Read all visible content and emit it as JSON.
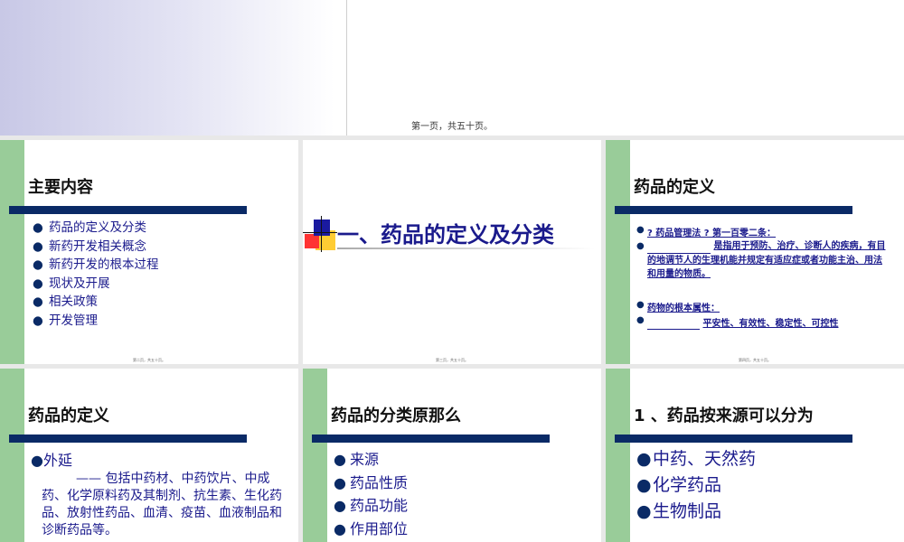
{
  "top_caption": "第一页，共五十页。",
  "slide2": {
    "title": "主要内容",
    "items": [
      "药品的定义及分类",
      "新药开发相关概念",
      "新药开发的根本过程",
      "现状及开展",
      "相关政策",
      "开发管理"
    ],
    "footer": "第二页，共五十页。"
  },
  "slide3": {
    "title": "一、药品的定义及分类",
    "footer": "第三页，共五十页。"
  },
  "slide4": {
    "title": "药品的定义",
    "law_line": "? 药品管理法 ? 第一百零二条：",
    "definition": "是指用于预防、治疗、诊断人的疾病，有目的地调节人的生理机能并规定有适应症或者功能主治、用法和用量的物质。",
    "attr_heading": "药物的根本属性：",
    "attrs": "平安性、有效性、稳定性、可控性",
    "footer": "第四页，共五十页。"
  },
  "slide5": {
    "title": "药品的定义",
    "item": "外延",
    "body": "—— 包括中药材、中药饮片、中成药、化学原料药及其制剂、抗生素、生化药品、放射性药品、血清、疫苗、血液制品和诊断药品等。"
  },
  "slide6": {
    "title": "药品的分类原那么",
    "items": [
      "来源",
      "药品性质",
      "药品功能",
      "作用部位"
    ]
  },
  "slide7": {
    "title": "1 、药品按来源可以分为",
    "items": [
      "中药、天然药",
      "化学药品",
      "生物制品"
    ]
  },
  "colors": {
    "stripe": "#99cc99",
    "bar": "#0a2a66",
    "text_blue": "#1a1a8c"
  }
}
